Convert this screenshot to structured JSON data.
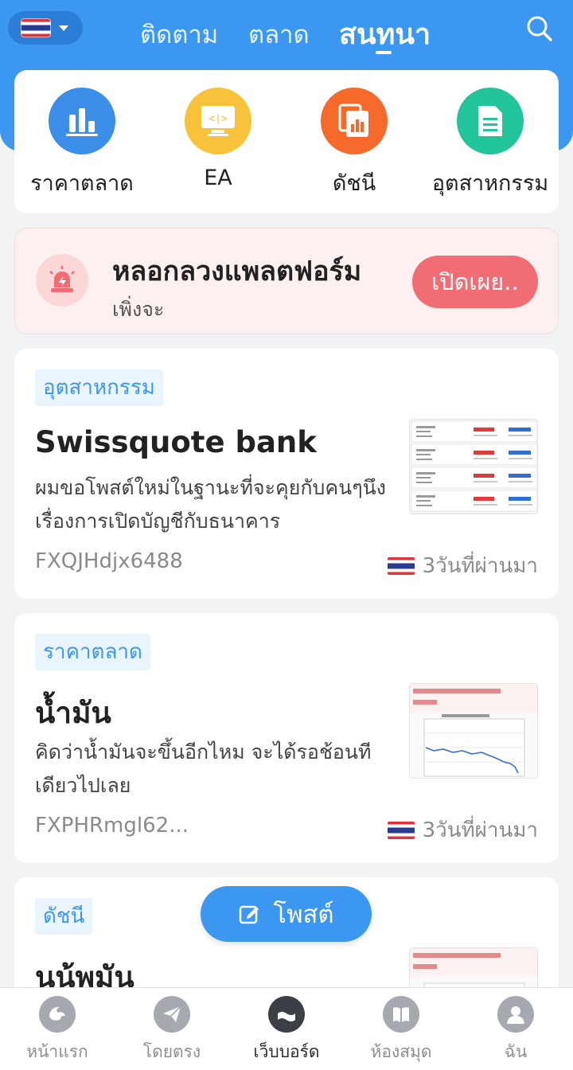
{
  "header": {
    "tabs": [
      {
        "label": "ติดตาม",
        "active": false
      },
      {
        "label": "ตลาด",
        "active": false
      },
      {
        "label": "สนทนา",
        "active": true
      }
    ],
    "accent_color": "#3b97f0"
  },
  "quick_menu": [
    {
      "label": "ราคาตลาด",
      "icon": "bar-chart-icon",
      "color": "#3b8fe8"
    },
    {
      "label": "EA",
      "icon": "monitor-code-icon",
      "color": "#f8c23a"
    },
    {
      "label": "ดัชนี",
      "icon": "report-icon",
      "color": "#f56a2a"
    },
    {
      "label": "อุตสาหกรรม",
      "icon": "document-icon",
      "color": "#22c59a"
    }
  ],
  "alert": {
    "title": "หลอกลวงแพลตฟอร์ม",
    "subtitle": "เพิ่งจะ",
    "button_label": "เปิดเผย.."
  },
  "posts": [
    {
      "tag": "อุตสาหกรรม",
      "title": "Swissquote bank",
      "excerpt": "ผมขอโพสต์ใหม่ในฐานะที่จะคุยกับคนๆนึงเรื่องการเปิดบัญชีกับธนาคาร",
      "author": "FXQJHdjx6488",
      "time": "3วันที่ผ่านมา",
      "thumbnail": "quotes-thumbnail"
    },
    {
      "tag": "ราคาตลาด",
      "title": "น้ำมัน",
      "excerpt": "คิดว่าน้ำมันจะขึ้นอีกไหม จะได้รอช้อนทีเดียวไปเลย",
      "author": "FXPHRmgl62...",
      "time": "3วันที่ผ่านมา",
      "thumbnail": "chart-thumbnail"
    },
    {
      "tag": "ดัชนี",
      "title": "นน้พมัน",
      "thumbnail": "chart-thumbnail"
    }
  ],
  "fab": {
    "label": "โพสต์"
  },
  "bottom_nav": [
    {
      "label": "หน้าแรก",
      "icon": "home-icon",
      "active": false
    },
    {
      "label": "โดยตรง",
      "icon": "send-icon",
      "active": false
    },
    {
      "label": "เว็บบอร์ด",
      "icon": "forum-icon",
      "active": true
    },
    {
      "label": "ห้องสมุด",
      "icon": "book-icon",
      "active": false
    },
    {
      "label": "ฉัน",
      "icon": "user-icon",
      "active": false
    }
  ]
}
